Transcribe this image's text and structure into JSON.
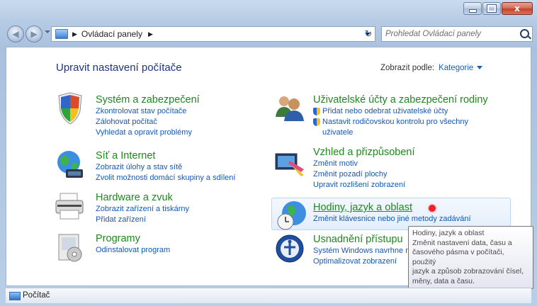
{
  "window": {
    "controls": {
      "minimize": "",
      "maximize": "",
      "close": "x"
    }
  },
  "navbar": {
    "back_glyph": "◀",
    "forward_glyph": "▶",
    "address_separator": "▶",
    "address_text": "Ovládací panely",
    "refresh_glyph": "↻",
    "search_placeholder": "Prohledat Ovládací panely"
  },
  "content": {
    "page_title": "Upravit nastavení počítače",
    "view_by_label": "Zobrazit podle:",
    "view_by_value": "Kategorie",
    "categories": [
      {
        "title": "Systém a zabezpečení",
        "links": [
          "Zkontrolovat stav počítače",
          "Zálohovat počítač",
          "Vyhledat a opravit problémy"
        ]
      },
      {
        "title": "Síť a Internet",
        "links": [
          "Zobrazit úlohy a stav sítě",
          "Zvolit možnosti domácí skupiny a sdílení"
        ]
      },
      {
        "title": "Hardware a zvuk",
        "links": [
          "Zobrazit zařízení a tiskárny",
          "Přidat zařízení"
        ]
      },
      {
        "title": "Programy",
        "links": [
          "Odinstalovat program"
        ]
      },
      {
        "title": "Uživatelské účty a zabezpečení rodiny",
        "links": [
          "Přidat nebo odebrat uživatelské účty",
          "Nastavit rodičovskou kontrolu pro všechny",
          "uživatele"
        ]
      },
      {
        "title": "Vzhled a přizpůsobení",
        "links": [
          "Změnit motiv",
          "Změnit pozadí plochy",
          "Upravit rozlišení zobrazení"
        ]
      },
      {
        "title": "Hodiny, jazyk a oblast",
        "links": [
          "Změnit klávesnice nebo jiné metody zadávání"
        ]
      },
      {
        "title": "Usnadnění přístupu",
        "links": [
          "Systém Windows navrhne n",
          "Optimalizovat zobrazení"
        ]
      }
    ]
  },
  "tooltip": {
    "lines": [
      "Hodiny, jazyk a oblast",
      "Změnit nastavení data, času a",
      "časového pásma v počítači, použitý",
      "jazyk a způsob zobrazování čísel,",
      "měny, data a času."
    ]
  },
  "statusbar": {
    "label": "Počítač"
  },
  "colors": {
    "category_title": "#1c8a1c",
    "link": "#1458b8",
    "page_title": "#1e3287"
  }
}
